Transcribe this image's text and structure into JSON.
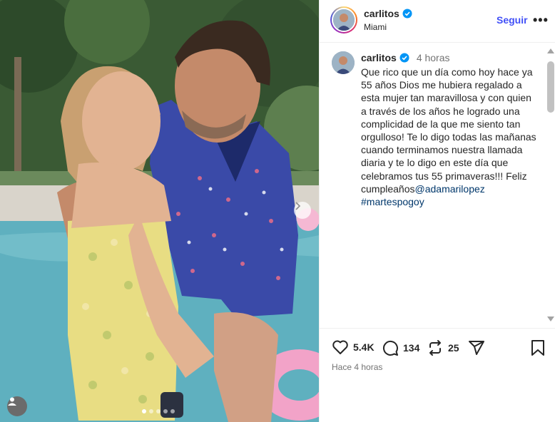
{
  "post": {
    "author": "carlitos",
    "location": "Miami",
    "follow_label": "Seguir",
    "more_label": "•••",
    "caption_time": "4 horas",
    "caption_text": "Que rico que un día como hoy hace ya 55 años Dios me hubiera regalado a esta mujer tan maravillosa y con quien a través de los años he logrado una complicidad de la que me siento tan orgulloso! Te lo digo todas las mañanas cuando terminamos nuestra llamada diaria y te lo digo en este día que celebramos tus 55 primaveras!!! Feliz cumpleaños",
    "mention": "@adamarilopez",
    "hashtag": "#martespogoy",
    "likes": "5.4K",
    "comments": "134",
    "reposts": "25",
    "timestamp": "Hace 4 horas",
    "carousel": {
      "count": 5,
      "active": 0
    }
  },
  "colors": {
    "accent": "#4150f7",
    "link": "#00376b",
    "verified": "#0095f6"
  }
}
